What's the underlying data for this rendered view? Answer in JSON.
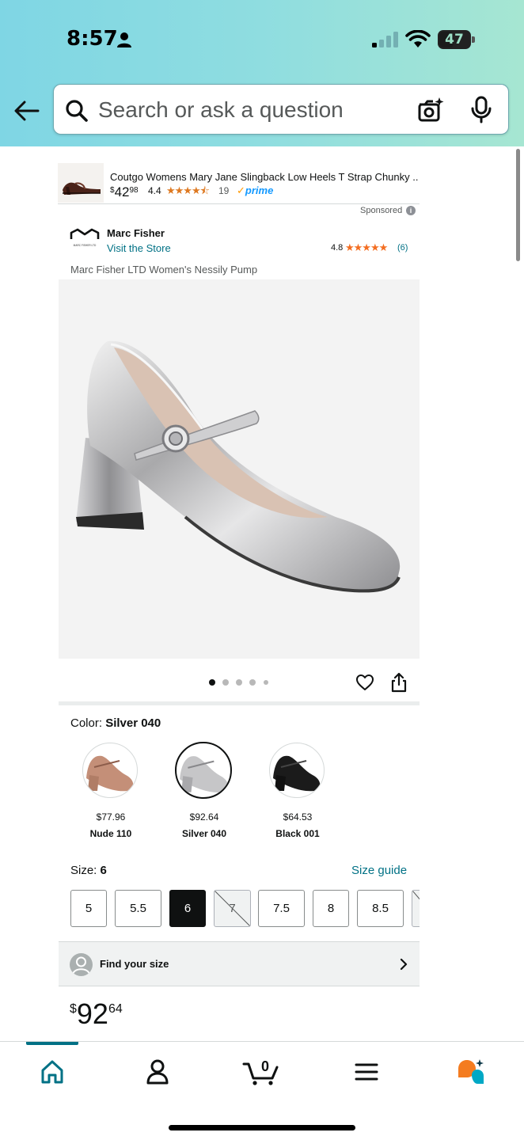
{
  "status_bar": {
    "time": "8:57",
    "battery": "47"
  },
  "search": {
    "placeholder": "Search or ask a question"
  },
  "sponsored_ad": {
    "title": "Coutgo Womens Mary Jane Slingback Low Heels T Strap Chunky ...",
    "price_dollars": "42",
    "price_cents": "98",
    "currency": "$",
    "rating": "4.4",
    "stars": "★★★★⯪",
    "review_count": "19",
    "prime_check": "✓",
    "prime_label": "prime",
    "sponsored_label": "Sponsored"
  },
  "brand": {
    "name": "Marc Fisher",
    "visit_store": "Visit the Store",
    "rating": "4.8",
    "stars": "★★★★★",
    "review_count": "(6)",
    "logo_text": "MARC FISHER LTD"
  },
  "product": {
    "title": "Marc Fisher LTD Women's Nessily Pump",
    "carousel_index": 1,
    "carousel_total": 5
  },
  "color": {
    "label": "Color: ",
    "selected": "Silver 040",
    "options": [
      {
        "price": "$77.96",
        "name": "Nude 110",
        "tone": "#c99a86"
      },
      {
        "price": "$92.64",
        "name": "Silver 040",
        "tone": "#c7c7c9"
      },
      {
        "price": "$64.53",
        "name": "Black 001",
        "tone": "#1a1a1a"
      }
    ]
  },
  "size": {
    "label": "Size: ",
    "selected": "6",
    "guide_label": "Size guide",
    "options": [
      "5",
      "5.5",
      "6",
      "7",
      "7.5",
      "8",
      "8.5"
    ]
  },
  "find_size": {
    "label": "Find your size"
  },
  "price": {
    "currency": "$",
    "dollars": "92",
    "cents": "64"
  },
  "colors": {
    "link": "#007185",
    "star": "#de7921",
    "prime": "#1399ff",
    "header_gradient_start": "#7fd6e4",
    "header_gradient_end": "#a6e6d2"
  },
  "bottom_nav": {
    "items": [
      "home-icon",
      "account-icon",
      "cart-icon",
      "menu-icon",
      "rufus-icon"
    ],
    "cart_count": "0"
  }
}
